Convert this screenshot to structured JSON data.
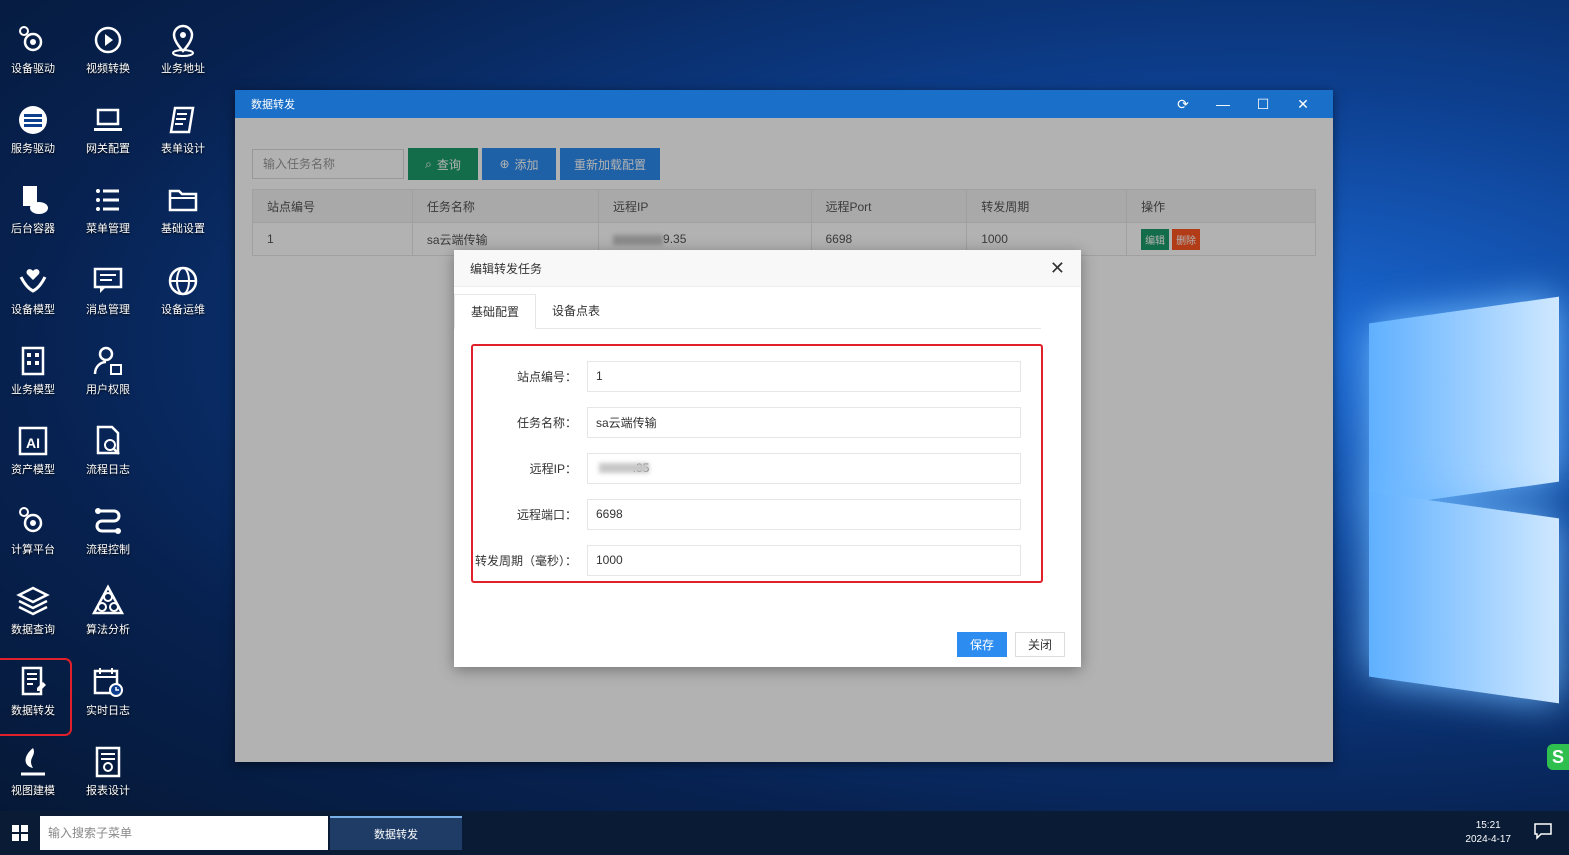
{
  "desktop": {
    "icons": [
      {
        "label": "设备驱动",
        "icon": "gears-icon"
      },
      {
        "label": "视频转换",
        "icon": "play-icon"
      },
      {
        "label": "业务地址",
        "icon": "location-pin-icon"
      },
      {
        "label": "服务驱动",
        "icon": "server-icon"
      },
      {
        "label": "网关配置",
        "icon": "laptop-icon"
      },
      {
        "label": "表单设计",
        "icon": "form-edit-icon"
      },
      {
        "label": "后台容器",
        "icon": "cloud-doc-icon"
      },
      {
        "label": "菜单管理",
        "icon": "list-icon"
      },
      {
        "label": "基础设置",
        "icon": "folder-icon"
      },
      {
        "label": "设备模型",
        "icon": "hands-icon"
      },
      {
        "label": "消息管理",
        "icon": "message-icon"
      },
      {
        "label": "设备运维",
        "icon": "globe-icon"
      },
      {
        "label": "业务模型",
        "icon": "building-icon"
      },
      {
        "label": "用户权限",
        "icon": "user-lock-icon"
      },
      {
        "label": "资产模型",
        "icon": "ai-icon"
      },
      {
        "label": "流程日志",
        "icon": "doc-search-icon"
      },
      {
        "label": "计算平台",
        "icon": "gears-icon"
      },
      {
        "label": "流程控制",
        "icon": "flow-icon"
      },
      {
        "label": "数据查询",
        "icon": "layers-icon"
      },
      {
        "label": "算法分析",
        "icon": "algorithm-icon"
      },
      {
        "label": "数据转发",
        "icon": "doc-edit-icon"
      },
      {
        "label": "实时日志",
        "icon": "calendar-clock-icon"
      },
      {
        "label": "视图建模",
        "icon": "flame-icon"
      },
      {
        "label": "报表设计",
        "icon": "report-icon"
      }
    ]
  },
  "window": {
    "title": "数据转发",
    "search_placeholder": "输入任务名称",
    "btn_query": "查询",
    "btn_add": "添加",
    "btn_reload": "重新加载配置",
    "columns": [
      "站点编号",
      "任务名称",
      "远程IP",
      "远程Port",
      "转发周期",
      "操作"
    ],
    "row": {
      "station": "1",
      "name": "sa云端传输",
      "ip_suffix": "9.35",
      "port": "6698",
      "period": "1000",
      "edit": "编辑",
      "delete": "删除"
    }
  },
  "dialog": {
    "title": "编辑转发任务",
    "tab_basic": "基础配置",
    "tab_points": "设备点表",
    "label_station": "站点编号：",
    "label_name": "任务名称：",
    "label_ip": "远程IP：",
    "label_port": "远程端口：",
    "label_period": "转发周期（毫秒）：",
    "value_station": "1",
    "value_name": "sa云端传输",
    "value_ip": "           .35",
    "value_port": "6698",
    "value_period": "1000",
    "btn_save": "保存",
    "btn_close": "关闭"
  },
  "taskbar": {
    "search_placeholder": "输入搜索子菜单",
    "task_label": "数据转发",
    "time": "15:21",
    "date": "2024-4-17"
  }
}
